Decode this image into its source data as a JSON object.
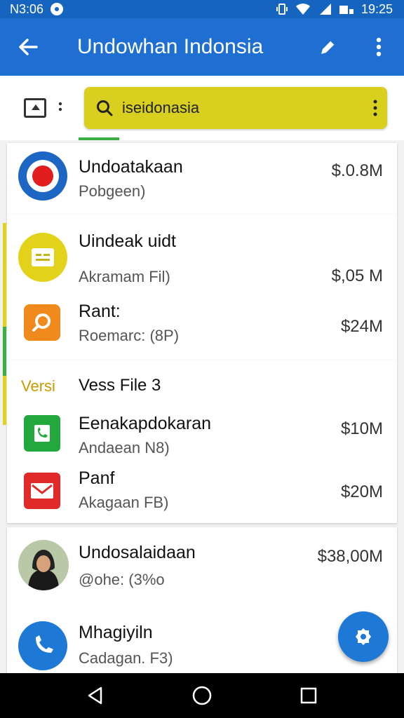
{
  "status_bar": {
    "time_left": "N3:06",
    "time_right": "19:25"
  },
  "app_bar": {
    "title": "Undowhan Indonsia"
  },
  "search": {
    "value": "iseidonasia"
  },
  "card1": {
    "items": [
      {
        "name": "Undoatakaan",
        "sub": "Pobgeen)",
        "amount": "$.0.8M"
      }
    ]
  },
  "card2": {
    "items": [
      {
        "name": "Uindeak uidt",
        "sub": "Akramam Fil)",
        "amount": "$,05 M"
      },
      {
        "name": "Rant:",
        "sub": "Roemarc: (8P)",
        "amount": "$24M"
      }
    ]
  },
  "card3": {
    "section_tag": "Versi",
    "section_title": "Vess File 3",
    "items": [
      {
        "name": "Eenakapdokaran",
        "sub": "Andaean N8)",
        "amount": "$10M"
      },
      {
        "name": "Panf",
        "sub": "Akagaan FB)",
        "amount": "$20M"
      }
    ]
  },
  "card4": {
    "items": [
      {
        "name": "Undosalaidaan",
        "sub": "@ohe: (3%o",
        "amount": "$38,00M"
      },
      {
        "name": "Mhagiyiln",
        "sub": "Cadagan. F3)",
        "amount": ""
      }
    ]
  },
  "colors": {
    "primary": "#1e6fd1",
    "search_bg": "#d9cf1f",
    "accent_green": "#3cb043"
  }
}
